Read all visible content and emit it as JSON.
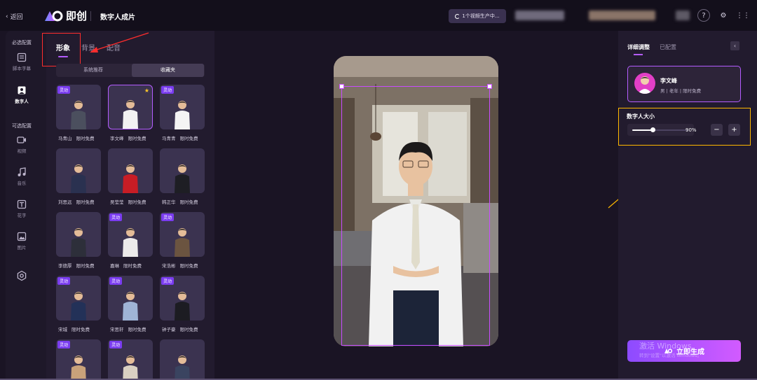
{
  "topbar": {
    "back_label": "返回",
    "logo_text": "即创",
    "page_title": "数字人成片",
    "progress_text": "1个视频生产中..."
  },
  "rail": {
    "section_required": "必选配置",
    "section_optional": "可选配置",
    "items": [
      {
        "label": "脚本字幕",
        "icon": "script-icon"
      },
      {
        "label": "数字人",
        "icon": "avatar-icon"
      },
      {
        "label": "视频",
        "icon": "video-icon"
      },
      {
        "label": "音乐",
        "icon": "music-icon"
      },
      {
        "label": "花字",
        "icon": "text-icon"
      },
      {
        "label": "图片",
        "icon": "image-icon"
      },
      {
        "label": "",
        "icon": "more-icon"
      }
    ]
  },
  "left_panel": {
    "tabs": [
      "形象",
      "背景",
      "配音"
    ],
    "active_tab": 0,
    "segments": [
      "系统推荐",
      "收藏夹"
    ],
    "active_segment": 1,
    "free_label": "限时免费",
    "badge_label": "灵动",
    "avatars": [
      {
        "name": "马青山",
        "badge": true,
        "selected": false,
        "starred": false,
        "shirt": "#4b4f5e"
      },
      {
        "name": "李文峰",
        "badge": false,
        "selected": true,
        "starred": true,
        "shirt": "#f2f2f2"
      },
      {
        "name": "马青青",
        "badge": true,
        "selected": false,
        "starred": false,
        "shirt": "#f4f4f4"
      },
      {
        "name": "刘思远",
        "badge": false,
        "selected": false,
        "starred": false,
        "shirt": "#2a3150"
      },
      {
        "name": "吴莹莹",
        "badge": false,
        "selected": false,
        "starred": false,
        "shirt": "#c81d25"
      },
      {
        "name": "韩正华",
        "badge": false,
        "selected": false,
        "starred": false,
        "shirt": "#1e1e24"
      },
      {
        "name": "李德厚",
        "badge": false,
        "selected": false,
        "starred": false,
        "shirt": "#2d2f3a"
      },
      {
        "name": "嘉琳",
        "badge": true,
        "selected": false,
        "starred": false,
        "shirt": "#eceaea"
      },
      {
        "name": "宋浩彬",
        "badge": true,
        "selected": false,
        "starred": false,
        "shirt": "#6b5440"
      },
      {
        "name": "宋城",
        "badge": true,
        "selected": false,
        "starred": false,
        "shirt": "#233158"
      },
      {
        "name": "宋思轩",
        "badge": true,
        "selected": false,
        "starred": false,
        "shirt": "#9fb4d6"
      },
      {
        "name": "钟子豪",
        "badge": true,
        "selected": false,
        "starred": false,
        "shirt": "#1c1c22"
      },
      {
        "name": "",
        "badge": true,
        "selected": false,
        "starred": false,
        "shirt": "#c9a27a"
      },
      {
        "name": "",
        "badge": true,
        "selected": false,
        "starred": false,
        "shirt": "#d9d0c2"
      },
      {
        "name": "",
        "badge": false,
        "selected": false,
        "starred": false,
        "shirt": "#3a4460"
      }
    ]
  },
  "right_panel": {
    "tabs": [
      "详细调整",
      "已配置"
    ],
    "active_tab": 0,
    "avatar_name": "李文峰",
    "avatar_meta": "男 | 老年 | 限时免费",
    "size_title": "数字人大小",
    "size_percent": 90,
    "size_label": "90%",
    "minus_label": "−",
    "plus_label": "+",
    "generate_label": "立即生成",
    "watermark_title": "激活 Windows",
    "watermark_sub": "转到\"设置\"以激活 Windows。"
  },
  "colors": {
    "accent": "#b45cff",
    "highlight_red": "#ff2d2d",
    "highlight_yellow": "#ffb800"
  }
}
